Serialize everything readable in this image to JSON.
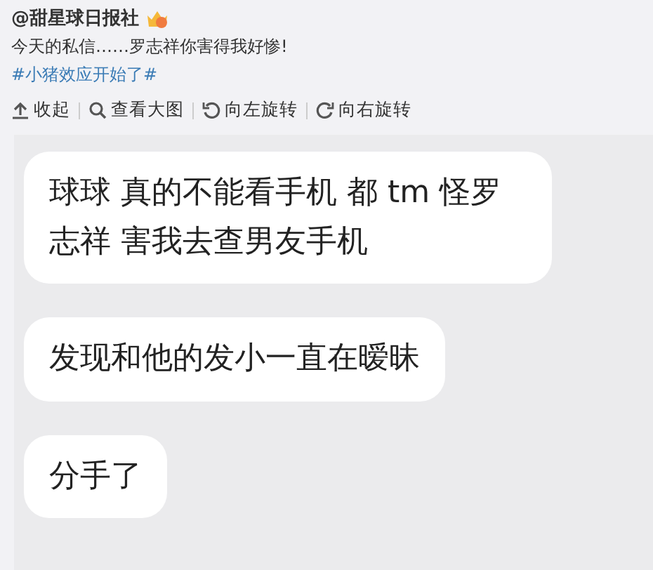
{
  "post": {
    "author": "@甜星球日报社",
    "text": "今天的私信……罗志祥你害得我好惨!",
    "hashtag": "#小猪效应开始了#"
  },
  "toolbar": [
    {
      "kind": "collapse",
      "label": "收起"
    },
    {
      "kind": "zoom",
      "label": "查看大图"
    },
    {
      "kind": "rotate-left",
      "label": "向左旋转"
    },
    {
      "kind": "rotate-right",
      "label": "向右旋转"
    }
  ],
  "messages": [
    {
      "text": "球球 真的不能看手机 都 tm 怪罗志祥 害我去查男友手机"
    },
    {
      "text": "发现和他的发小一直在暧昧"
    },
    {
      "text": "分手了"
    }
  ]
}
